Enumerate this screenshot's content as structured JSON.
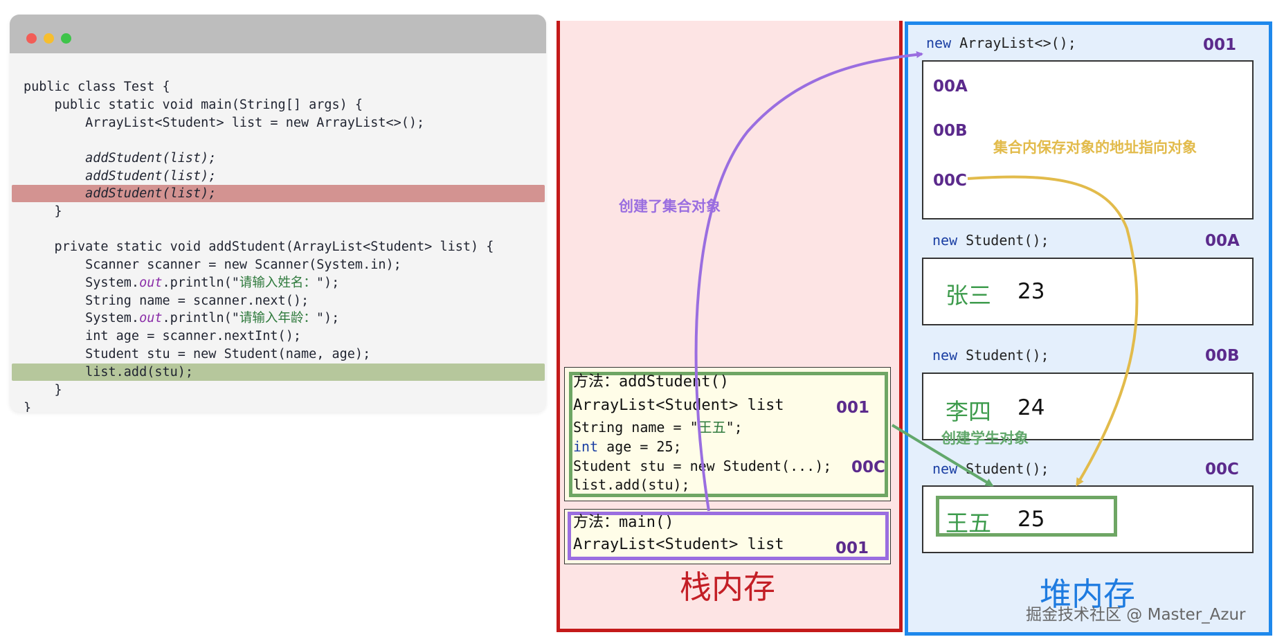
{
  "code": {
    "l1": "public class Test {",
    "l2": "    public static void main(String[] args) {",
    "l3": "        ArrayList<Student> list = new ArrayList<>();",
    "l5": "        addStudent(list);",
    "l6": "        addStudent(list);",
    "l7": "        addStudent(list);",
    "l8": "    }",
    "l10": "    private static void addStudent(ArrayList<Student> list) {",
    "l11": "        Scanner scanner = new Scanner(System.in);",
    "l12_a": "        System.",
    "l12_b": "out",
    "l12_c": ".println(\"",
    "l12_d": "请输入姓名：",
    "l12_e": "\");",
    "l13": "        String name = scanner.next();",
    "l14_a": "        System.",
    "l14_b": "out",
    "l14_c": ".println(\"",
    "l14_d": "请输入年龄：",
    "l14_e": "\");",
    "l15": "        int age = scanner.nextInt();",
    "l16": "        Student stu = new Student(name, age);",
    "l17": "        list.add(stu);",
    "l18": "    }",
    "l19": "}"
  },
  "stack": {
    "title": "栈内存",
    "frame_add": {
      "line1": "方法：addStudent()",
      "line2": "ArrayList<Student> list",
      "line2_addr": "001",
      "line3_a": "String name = \"",
      "line3_b": "王五",
      "line3_c": "\";",
      "line4_a": "int",
      "line4_b": " age = 25;",
      "line5": "Student stu = new Student(...);",
      "line5_addr": "00C",
      "line6": "list.add(stu);"
    },
    "frame_main": {
      "line1": "方法：main()",
      "line2": "ArrayList<Student> list",
      "line2_addr": "001"
    }
  },
  "heap": {
    "title": "堆内存",
    "list_new_kw": "new",
    "list_new_rest": " ArrayList<>();",
    "list_addr": "001",
    "list_items": [
      "00A",
      "00B",
      "00C"
    ],
    "students": [
      {
        "new_kw": "new",
        "new_rest": " Student();",
        "addr": "00A",
        "name": "张三",
        "age": "23"
      },
      {
        "new_kw": "new",
        "new_rest": " Student();",
        "addr": "00B",
        "name": "李四",
        "age": "24"
      },
      {
        "new_kw": "new",
        "new_rest": " Student();",
        "addr": "00C",
        "name": "王五",
        "age": "25"
      }
    ]
  },
  "annotations": {
    "create_collection": "创建了集合对象",
    "collection_holds": "集合内保存对象的地址指向对象",
    "create_student": "创建学生对象"
  },
  "colors": {
    "stack_border": "#c41a1a",
    "heap_border": "#1e88ec",
    "purple_arrow": "#9a6ee0",
    "yellow_arrow": "#e2bb4b",
    "green_arrow": "#62a86c"
  },
  "watermark": "掘金技术社区 @ Master_Azur"
}
